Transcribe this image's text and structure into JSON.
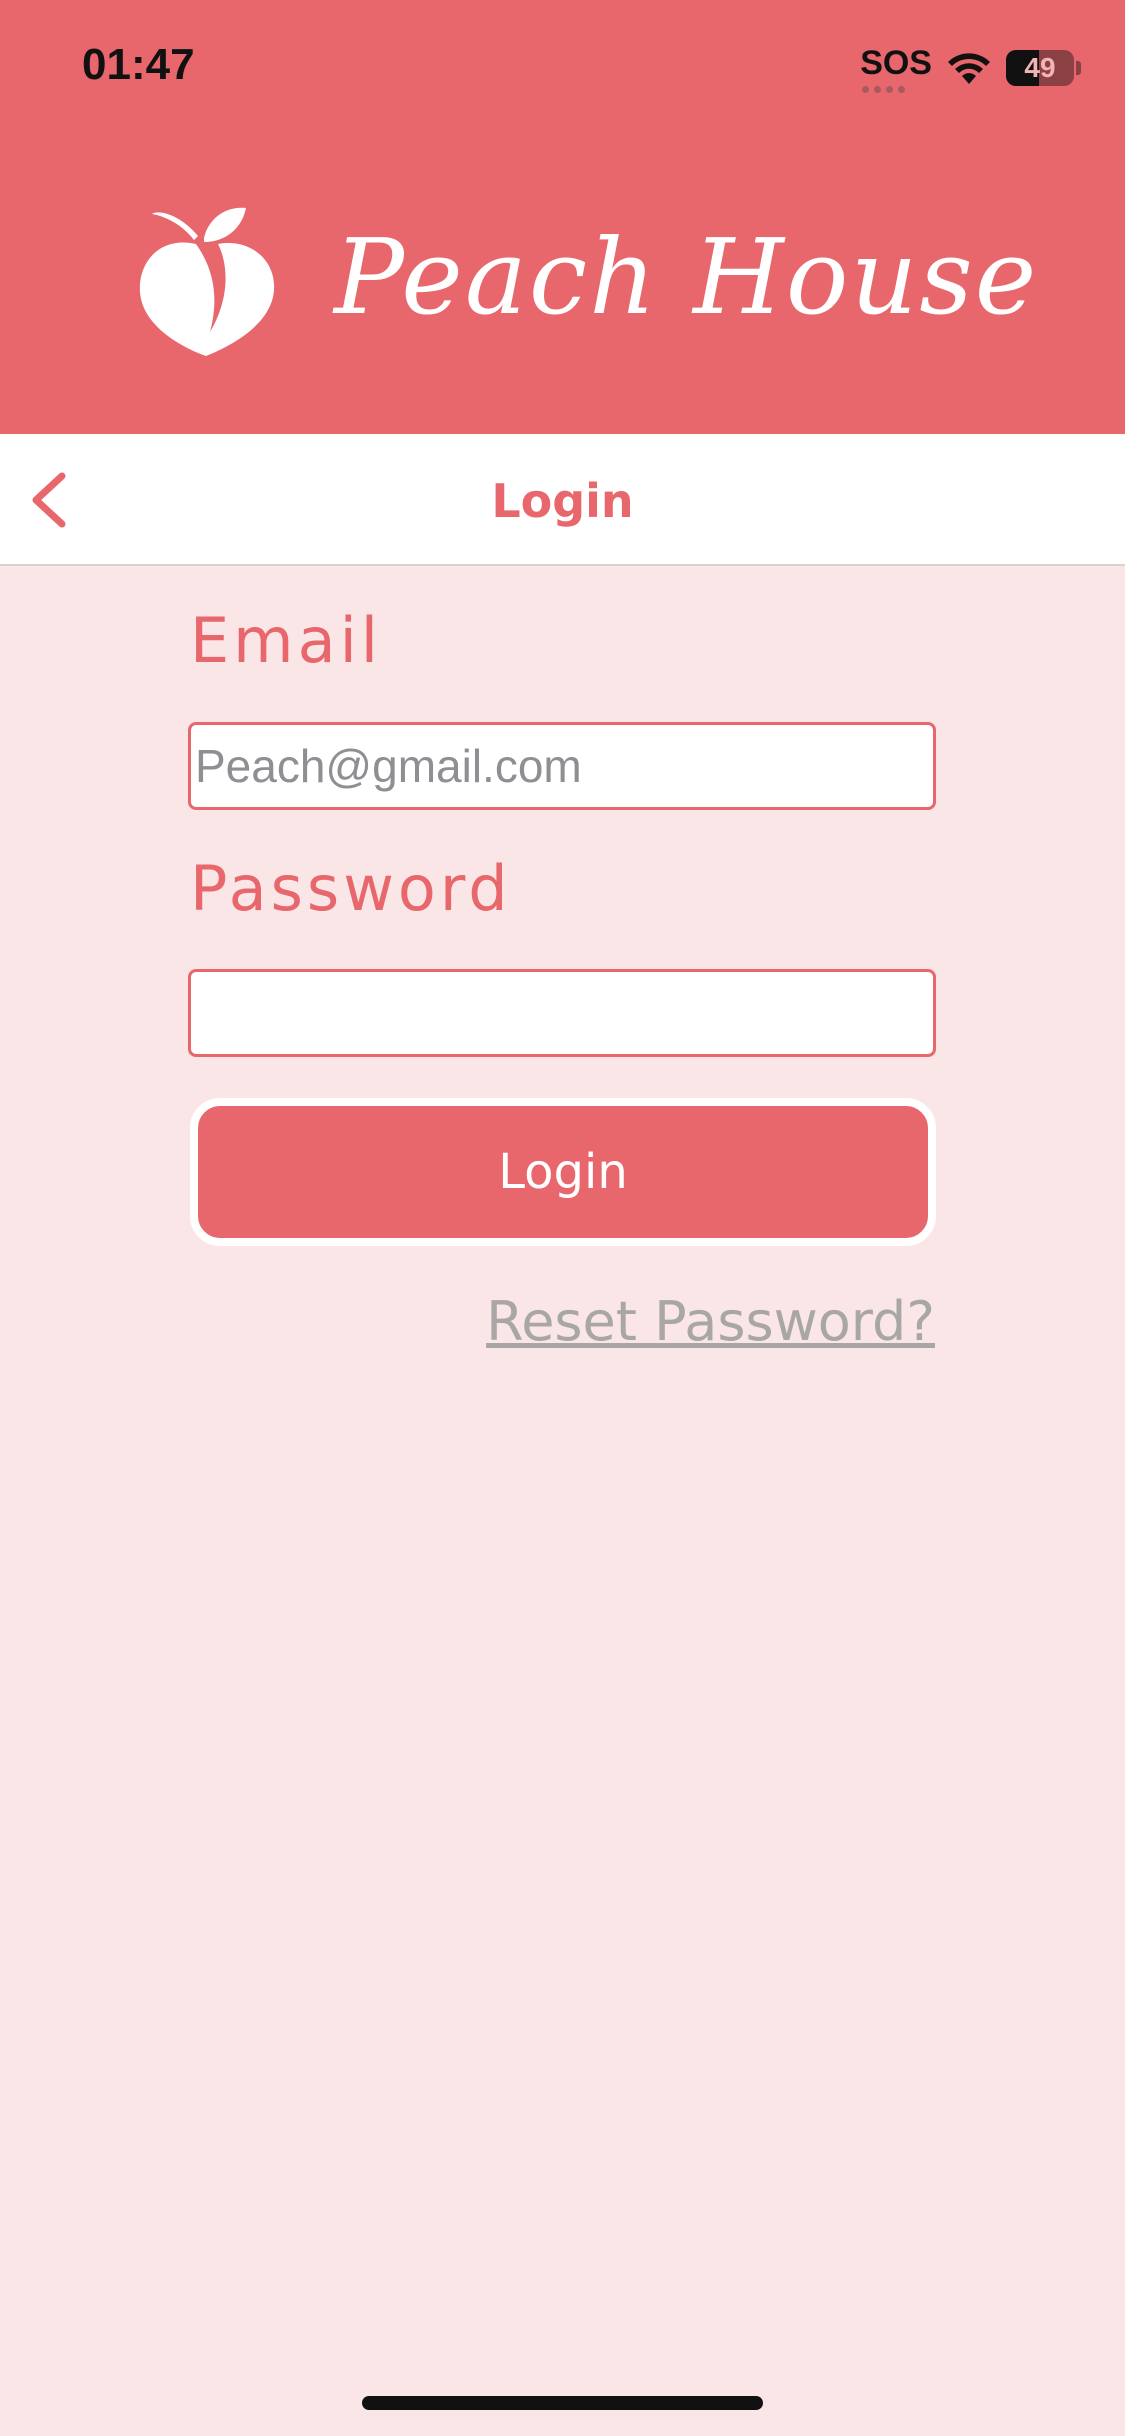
{
  "status_bar": {
    "time": "01:47",
    "sos": "SOS",
    "battery_level": "49",
    "icons": [
      "wifi-icon",
      "battery-icon"
    ]
  },
  "header": {
    "brand": "Peach House",
    "logo_icon": "peach-icon"
  },
  "nav": {
    "title": "Login",
    "back_icon": "chevron-left-icon"
  },
  "form": {
    "email_label": "Email",
    "email_placeholder": "Peach@gmail.com",
    "email_value": "",
    "password_label": "Password",
    "password_value": "",
    "login_button": "Login",
    "reset_link": "Reset Password?"
  },
  "colors": {
    "accent": "#e8676c",
    "background": "#fae6e6",
    "link": "#a9a6a6"
  }
}
